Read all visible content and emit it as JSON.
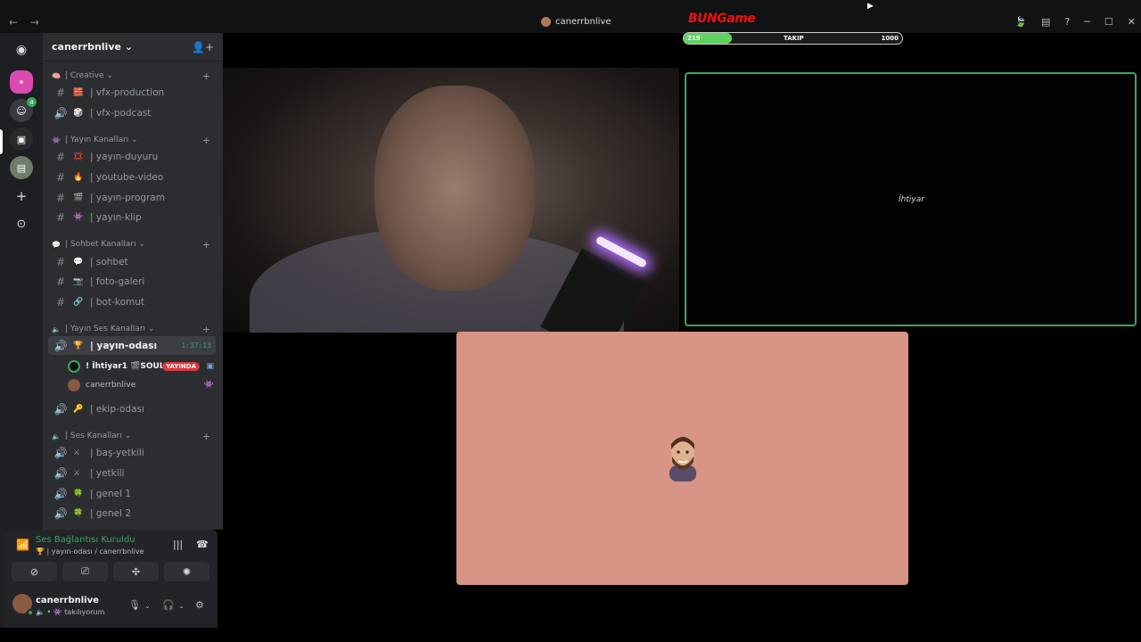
{
  "window": {
    "title": "canerrbnlive",
    "nav_back": "←",
    "nav_forward": "→",
    "controls": [
      "─",
      "☐",
      "✕"
    ]
  },
  "guilds": {
    "items": [
      {
        "name": "discord-home",
        "glyph": "◉"
      },
      {
        "name": "server-1",
        "glyph": "❀"
      },
      {
        "name": "server-2",
        "glyph": "☺",
        "badge": "4"
      },
      {
        "name": "server-3",
        "glyph": "▣"
      },
      {
        "name": "server-4",
        "glyph": "▤"
      },
      {
        "name": "add-server",
        "glyph": "+"
      },
      {
        "name": "explore",
        "glyph": "⊙"
      }
    ]
  },
  "sidebar": {
    "server_name": "canerrbnlive",
    "categories": [
      {
        "label": "| Creative",
        "icon": "🧠",
        "channels": [
          {
            "prefix": "#",
            "emoji": "🧱",
            "label": "| vfx-production"
          },
          {
            "prefix": "🔊",
            "emoji": "🎲",
            "label": "| vfx-podcast"
          }
        ]
      },
      {
        "label": "| Yayın Kanalları",
        "icon": "👾",
        "channels": [
          {
            "prefix": "#",
            "emoji": "💢",
            "label": "| yayın-duyuru"
          },
          {
            "prefix": "#",
            "emoji": "🔥",
            "label": "| youtube-video"
          },
          {
            "prefix": "#",
            "emoji": "🎬",
            "label": "| yayın-program"
          },
          {
            "prefix": "#",
            "emoji": "👾",
            "label": "| yayın-klip"
          }
        ]
      },
      {
        "label": "| Sohbet Kanalları",
        "icon": "💬",
        "channels": [
          {
            "prefix": "#",
            "emoji": "💬",
            "label": "| sohbet"
          },
          {
            "prefix": "#",
            "emoji": "📷",
            "label": "| foto-galeri"
          },
          {
            "prefix": "#",
            "emoji": "🔗",
            "label": "| bot-komut"
          }
        ]
      },
      {
        "label": "| Yayın Ses Kanalları",
        "icon": "🔈",
        "channels": [
          {
            "prefix": "🔊",
            "emoji": "🏆",
            "label": "| yayın-odası",
            "timer": "1:37:13"
          },
          {
            "prefix": "🔊",
            "emoji": "🔑",
            "label": "| ekip-odası"
          }
        ]
      },
      {
        "label": "| Ses Kanalları",
        "icon": "🔈",
        "channels": [
          {
            "prefix": "🔊",
            "emoji": "⚔",
            "label": "| baş-yetkili"
          },
          {
            "prefix": "🔊",
            "emoji": "⚔",
            "label": "| yetkili"
          },
          {
            "prefix": "🔊",
            "emoji": "🍀",
            "label": "| genel 1"
          },
          {
            "prefix": "🔊",
            "emoji": "🍀",
            "label": "| genel 2"
          }
        ]
      }
    ],
    "voice_users": [
      {
        "name": "! İhtiyar1 🎬SOUL",
        "live": "YAYINDA"
      },
      {
        "name": "canerrbnlive"
      }
    ]
  },
  "voice_panel": {
    "status": "Ses Bağlantısı Kuruldu",
    "sub": "🏆 | yayın-odası / canerrbnlive"
  },
  "user_panel": {
    "name": "canerrbnlive",
    "status": "🔈 • 👾 takılıyorum"
  },
  "overlay": {
    "brand": "BUNGame",
    "follow_current": "219",
    "follow_label": "TAKIP",
    "follow_target": "1000",
    "follow_progress": 0.219
  },
  "tiles": {
    "right_label": "İhtiyar"
  }
}
